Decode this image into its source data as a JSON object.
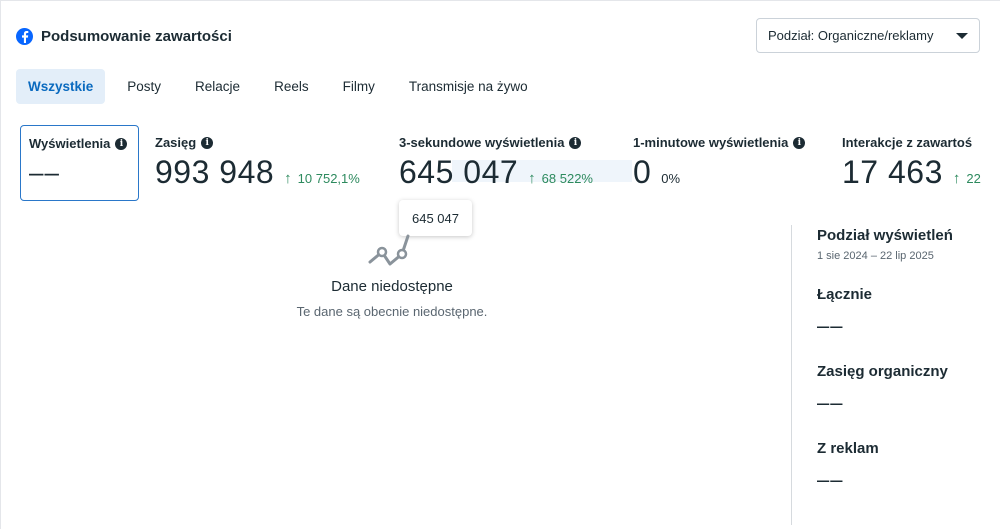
{
  "header": {
    "title": "Podsumowanie zawartości",
    "logo_icon": "facebook-icon",
    "breakdown_dropdown": "Podział: Organiczne/reklamy"
  },
  "tabs": [
    "Wszystkie",
    "Posty",
    "Relacje",
    "Reels",
    "Filmy",
    "Transmisje na żywo"
  ],
  "active_tab": "Wszystkie",
  "metrics": [
    {
      "label": "Wyświetlenia",
      "value": "––",
      "change": ""
    },
    {
      "label": "Zasięg",
      "value": "993 948",
      "change": "10 752,1%"
    },
    {
      "label": "3-sekundowe wyświetlenia",
      "value": "645 047",
      "change": "68 522%"
    },
    {
      "label": "1-minutowe wyświetlenia",
      "value": "0",
      "change": "0%"
    },
    {
      "label": "Interakcje z zawartoś",
      "value": "17 463",
      "change": "22"
    }
  ],
  "tooltip": "645 047",
  "empty_state": {
    "title": "Dane niedostępne",
    "subtitle": "Te dane są obecnie niedostępne."
  },
  "side_panel": {
    "title": "Podział wyświetleń",
    "date_range": "1 sie 2024 – 22 lip 2025",
    "blocks": [
      {
        "label": "Łącznie",
        "value": "––"
      },
      {
        "label": "Zasięg organiczny",
        "value": "––"
      },
      {
        "label": "Z reklam",
        "value": "––"
      }
    ]
  },
  "colors": {
    "accent": "#0866ff",
    "positive": "#2d8a5e",
    "active_tab_bg": "#e3eef9",
    "active_tab_text": "#0a6abf"
  }
}
